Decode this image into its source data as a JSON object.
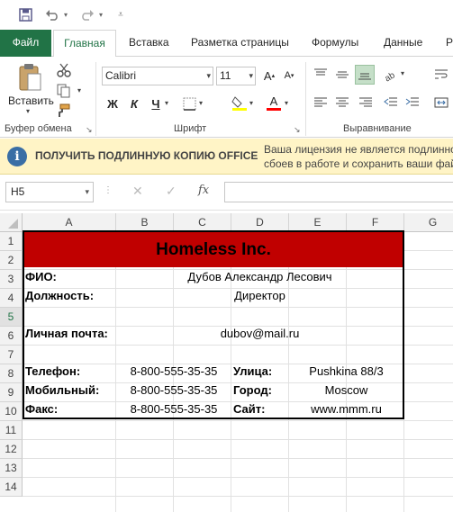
{
  "tabs": {
    "file": "Файл",
    "home": "Главная",
    "insert": "Вставка",
    "page_layout": "Разметка страницы",
    "formulas": "Формулы",
    "data": "Данные",
    "partial": "Р"
  },
  "ribbon": {
    "paste_label": "Вставить",
    "clipboard_group": "Буфер обмена",
    "font_group": "Шрифт",
    "align_group": "Выравнивание",
    "font_name": "Calibri",
    "font_size": "11",
    "bold": "Ж",
    "italic": "К",
    "underline": "Ч"
  },
  "infobar": {
    "title": "ПОЛУЧИТЬ ПОДЛИННУЮ КОПИЮ OFFICE",
    "text_line1": "Ваша лицензия не является подлинно",
    "text_line2": "сбоев в работе и сохранить ваши фай"
  },
  "formula_bar": {
    "name_box": "H5",
    "fx": "fx",
    "value": ""
  },
  "columns": [
    "A",
    "B",
    "C",
    "D",
    "E",
    "F",
    "G"
  ],
  "rows": [
    "1",
    "2",
    "3",
    "4",
    "5",
    "6",
    "7",
    "8",
    "9",
    "10",
    "11",
    "12",
    "13",
    "14"
  ],
  "selected_row": "5",
  "sheet": {
    "title": "Homeless Inc.",
    "fio_label": "ФИО:",
    "fio_value": "Дубов Александр Лесович",
    "position_label": "Должность:",
    "position_value": "Директор",
    "email_label": "Личная почта:",
    "email_value": "dubov@mail.ru",
    "phone_label": "Телефон:",
    "phone_value": "8-800-555-35-35",
    "mobile_label": "Мобильный:",
    "mobile_value": "8-800-555-35-35",
    "fax_label": "Факс:",
    "fax_value": "8-800-555-35-35",
    "street_label": "Улица:",
    "street_value": "Pushkina 88/3",
    "city_label": "Город:",
    "city_value": "Moscow",
    "site_label": "Сайт:",
    "site_value": "www.mmm.ru"
  },
  "colors": {
    "excel_green": "#217346",
    "title_fill": "#c00000",
    "info_bar": "#fff4c6",
    "fill_highlight": "#ffff00",
    "font_color": "#ff0000"
  }
}
